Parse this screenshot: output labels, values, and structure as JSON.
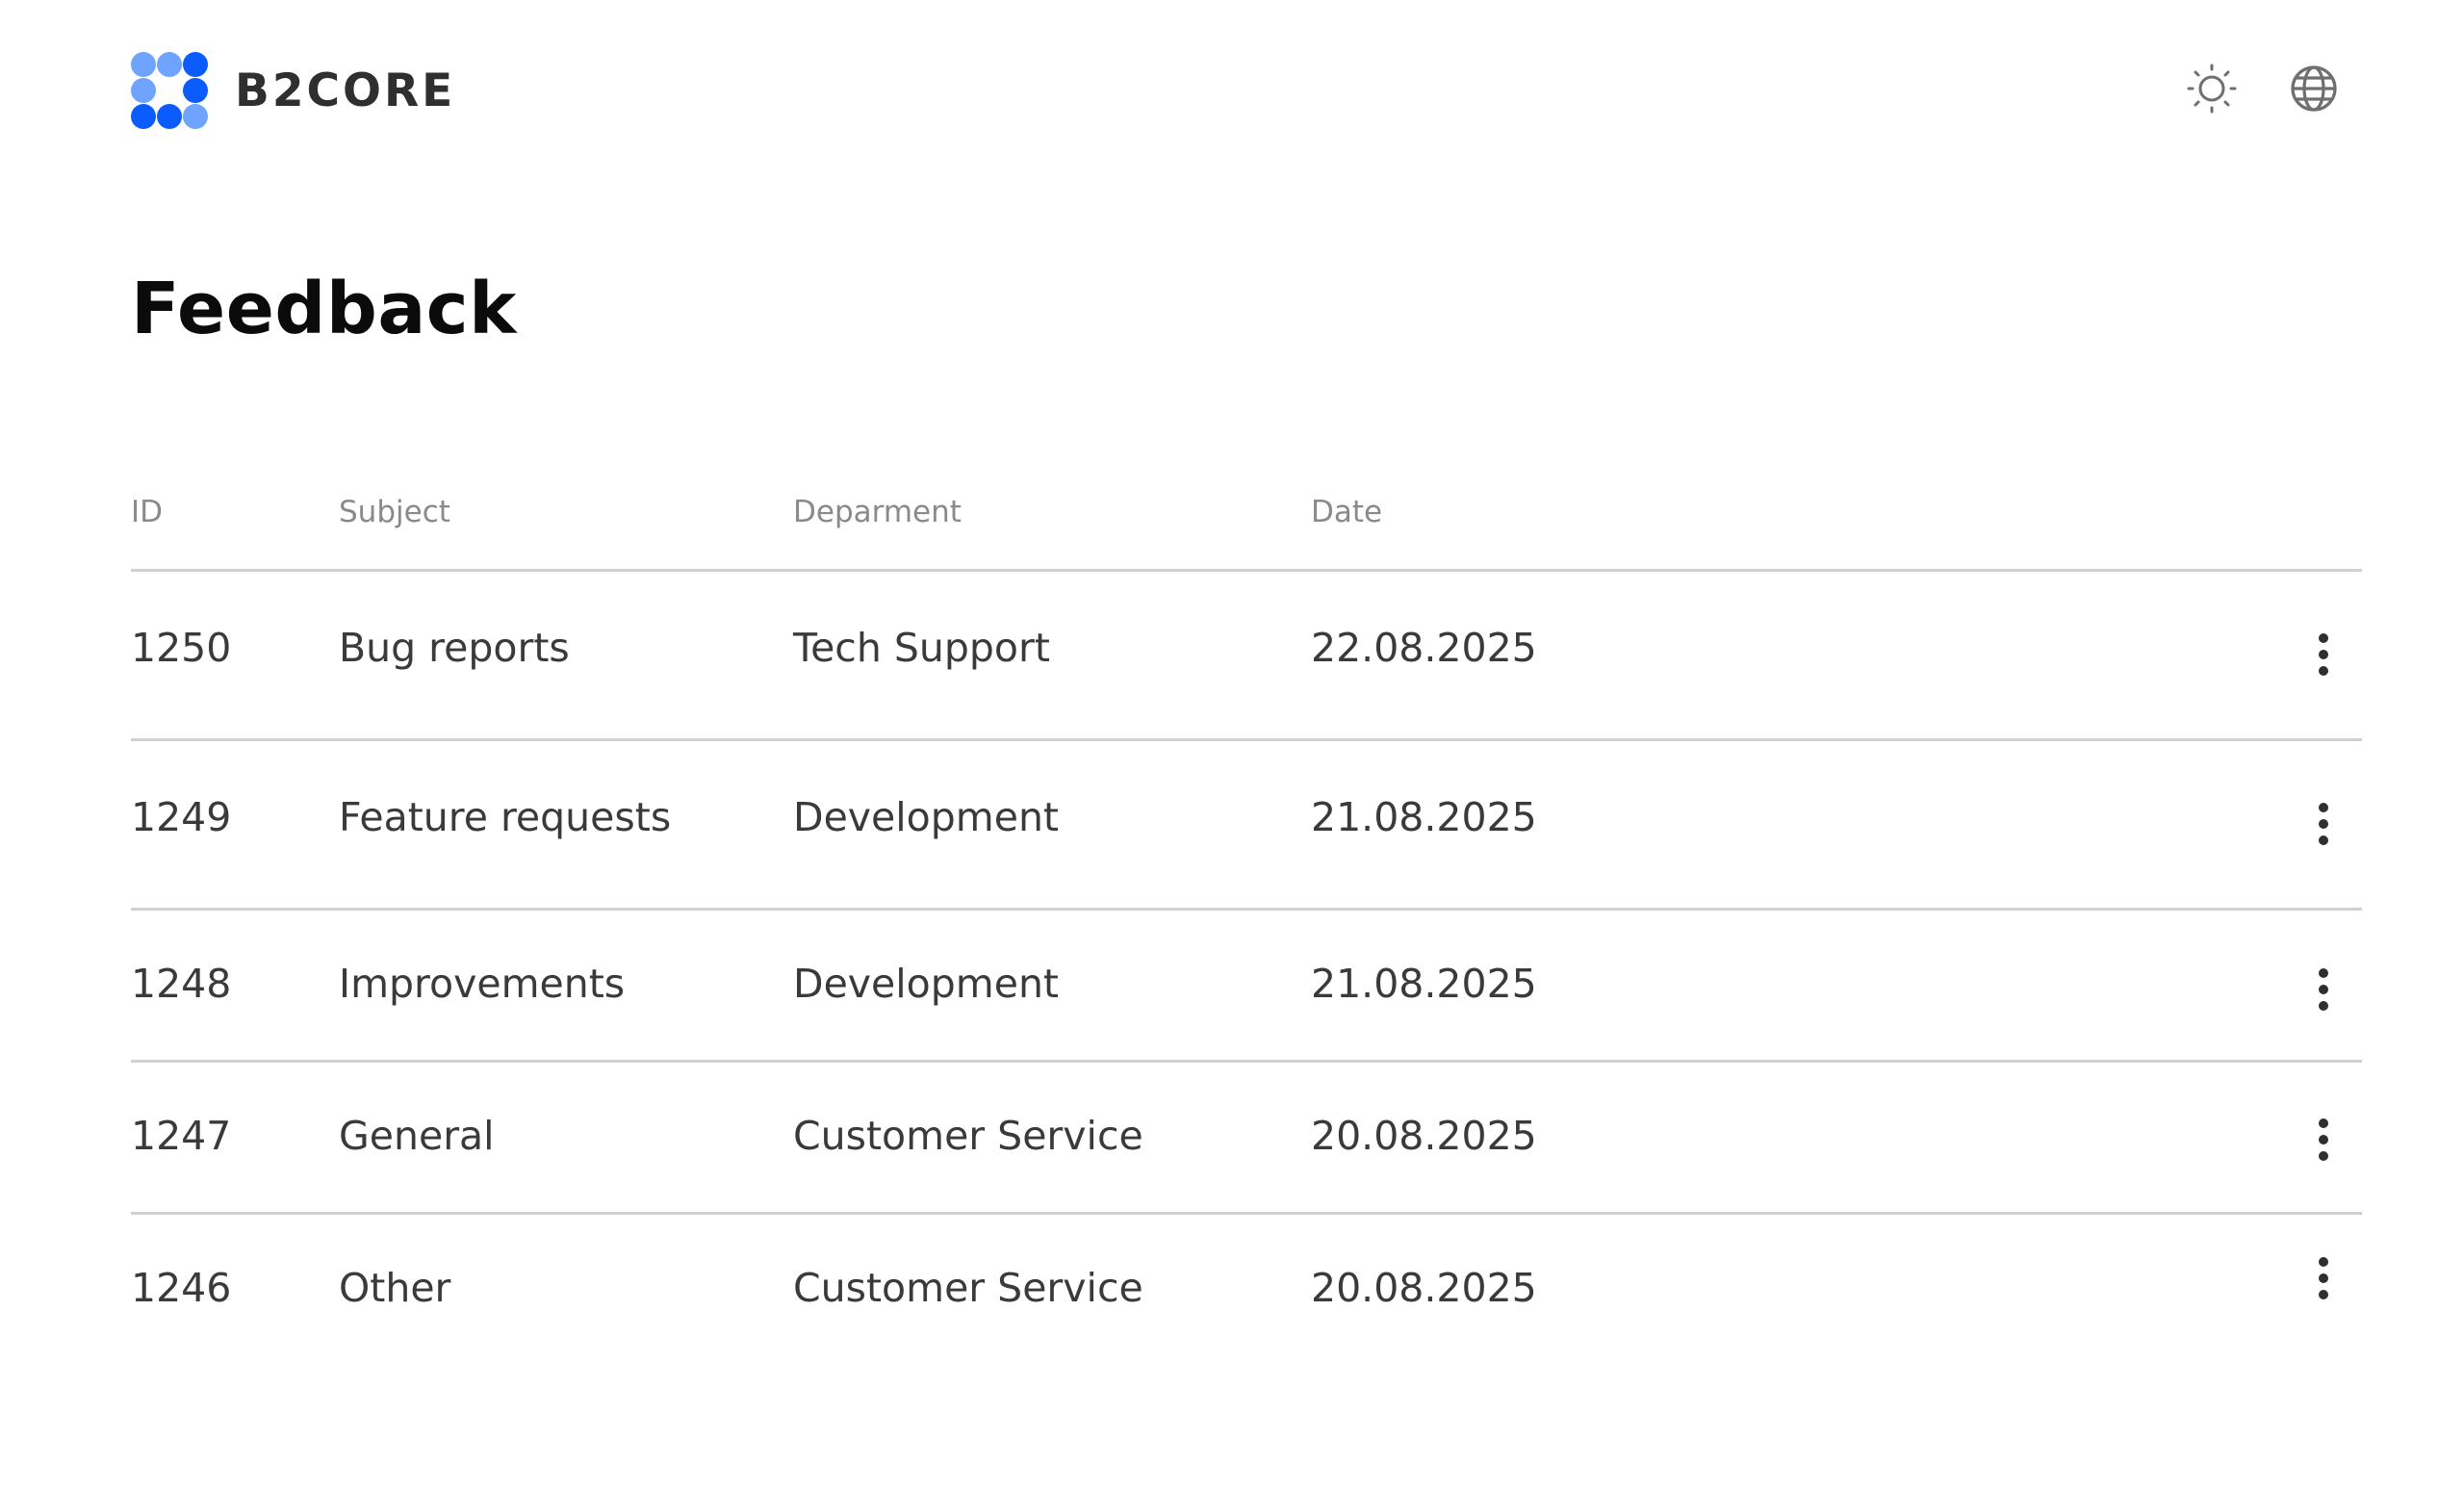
{
  "brand": {
    "name": "B2CORE",
    "colors": {
      "primary": "#0a5cff",
      "light": "#6ea3ff"
    },
    "icon": "b2core-logo-icon"
  },
  "header": {
    "actions": [
      {
        "icon": "sun-icon",
        "label": "theme"
      },
      {
        "icon": "globe-icon",
        "label": "language"
      }
    ]
  },
  "page": {
    "title": "Feedback"
  },
  "table": {
    "columns": [
      "ID",
      "Subject",
      "Deparment",
      "Date"
    ],
    "rows": [
      {
        "id": "1250",
        "subject": "Bug reports",
        "department": "Tech Support",
        "date": "22.08.2025"
      },
      {
        "id": "1249",
        "subject": "Feature requests",
        "department": "Development",
        "date": "21.08.2025"
      },
      {
        "id": "1248",
        "subject": "Improvements",
        "department": "Development",
        "date": "21.08.2025"
      },
      {
        "id": "1247",
        "subject": "General",
        "department": "Customer Service",
        "date": "20.08.2025"
      },
      {
        "id": "1246",
        "subject": "Other",
        "department": "Customer Service",
        "date": "20.08.2025"
      }
    ],
    "row_action_icon": "more-vertical-icon"
  }
}
